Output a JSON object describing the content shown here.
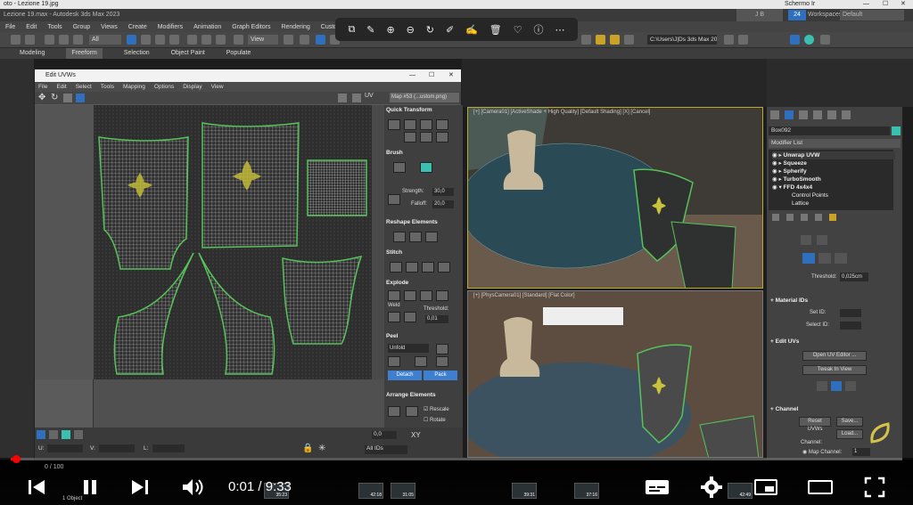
{
  "os": {
    "window_title": "oto - Lezione 19.jpg",
    "right_label": "Schermo Ir"
  },
  "app": {
    "title": "Lezione 19.max - Autodesk 3ds Max 2023",
    "menus": [
      "File",
      "Edit",
      "Tools",
      "Group",
      "Views",
      "Create",
      "Modifiers",
      "Animation",
      "Graph Editors",
      "Rendering",
      "Custo"
    ],
    "user": "J B",
    "workspace_label": "Workspaces:",
    "workspace_value": "Default",
    "path_field": "C:\\Users\\J|Ds  3ds Max 202",
    "view_dropdown": "View",
    "selection_dropdown": "All",
    "ribbon_tabs": [
      "Modeling",
      "Freeform",
      "Selection",
      "Object Paint",
      "Populate"
    ],
    "time_badge": "24"
  },
  "photo_viewer_toolbar": {
    "icons": [
      "crop-icon",
      "edit-icon",
      "zoom-in-icon",
      "zoom-out-icon",
      "rotate-icon",
      "annotate-icon",
      "draw-icon",
      "delete-icon",
      "heart-icon",
      "info-icon",
      "more-icon"
    ]
  },
  "uv_editor": {
    "title": "Edit UVWs",
    "menus": [
      "File",
      "Edit",
      "Select",
      "Tools",
      "Mapping",
      "Options",
      "Display",
      "View"
    ],
    "uv_label": "UV",
    "map_dropdown": "Map #53 (...ustom.png)",
    "sections": {
      "quick_transform": "Quick Transform",
      "brush": "Brush",
      "strength_label": "Strength:",
      "strength_value": "30,0",
      "falloff_label": "Falloff:",
      "falloff_value": "20,0",
      "reshape": "Reshape Elements",
      "stitch": "Stitch",
      "explode": "Explode",
      "weld_label": "Weld",
      "threshold_label": "Threshold:",
      "threshold_value": "0,01",
      "peel": "Peel",
      "peel_mode": "Unfold",
      "detach": "Detach",
      "pack": "Pack",
      "arrange": "Arrange Elements",
      "rescale": "Rescale",
      "rotate": "Rotate"
    },
    "status": {
      "u_label": "U:",
      "v_label": "V:",
      "l_label": "L:",
      "xy_label": "XY",
      "zoom_value": "0,0",
      "id_label": "All IDs"
    }
  },
  "viewports": {
    "top_label": "[+] [Camera01] [ActiveShade + High Quality] [Default Shading] [X] [Cancel]",
    "bottom_label": "[+] [PhysCamera01] [Standard] [Flat Color]"
  },
  "command_panel": {
    "object_name": "Box092",
    "modifier_list_label": "Modifier List",
    "stack": [
      "Unwrap UVW",
      "Squeeze",
      "Spherify",
      "TurboSmooth",
      "FFD 4x4x4",
      "Control Points",
      "Lattice"
    ],
    "threshold_label": "Threshold:",
    "threshold_value": "0,025cm",
    "material_ids": "Material IDs",
    "set_id_label": "Set ID:",
    "select_id_label": "Select ID:",
    "edit_uvs": "Edit UVs",
    "open_uv_editor": "Open UV Editor ...",
    "tweak_in_view": "Tweak In View",
    "channel": "Channel",
    "reset_uvws": "Reset UVWs",
    "save": "Save...",
    "load": "Load...",
    "channel_label": "Channel:",
    "map_channel_label": "Map Channel:",
    "map_channel_value": "1"
  },
  "status_bar": {
    "frame_counter": "0 / 100",
    "object_info": "1 Object"
  },
  "video_player": {
    "current_time": "0:01",
    "duration": "9:33",
    "time_display": "0:01 / 9:33",
    "played_fraction": 0.002,
    "thumbnail_times": [
      "35:23",
      "42:18",
      "31:05",
      "39:31",
      "37:16",
      "42:49"
    ],
    "controls": [
      "previous-icon",
      "pause-icon",
      "next-icon",
      "volume-icon",
      "subtitles-icon",
      "settings-icon",
      "miniplayer-icon",
      "theater-icon",
      "fullscreen-icon"
    ]
  }
}
